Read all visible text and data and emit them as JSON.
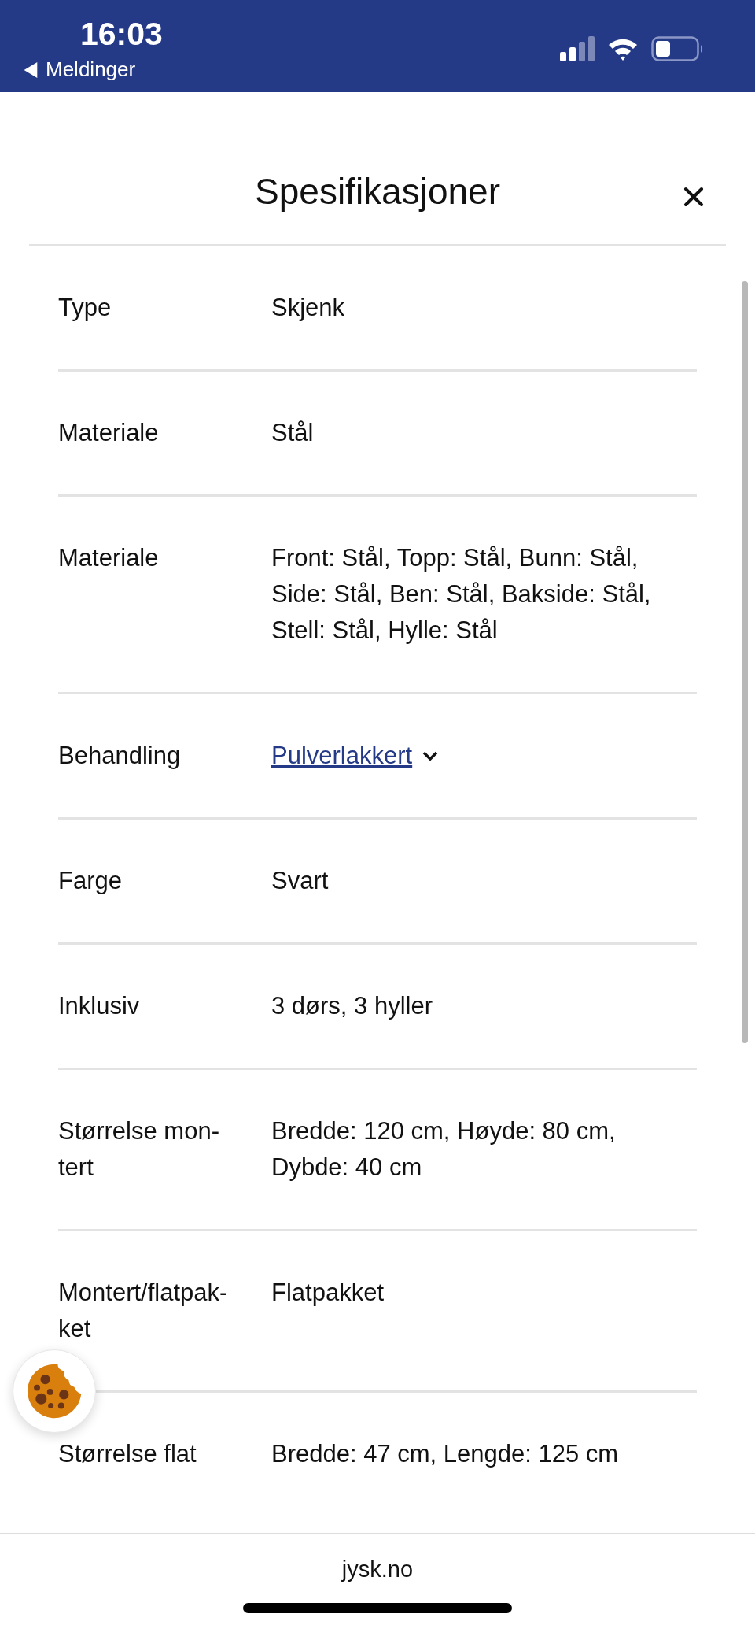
{
  "status_bar": {
    "time": "16:03",
    "back_label": "Meldinger"
  },
  "dialog": {
    "title": "Spesifikasjoner",
    "rows": [
      {
        "kind": "text",
        "label": "Type",
        "value": "Skjenk"
      },
      {
        "kind": "text",
        "label": "Materiale",
        "value": "Stål"
      },
      {
        "kind": "text",
        "label": "Materiale",
        "value": "Front: Stål, Topp: Stål, Bunn: Stål, Side: Stål, Ben: Stål, Bakside: Stål, Stell: Stål, Hylle: Stål"
      },
      {
        "kind": "link",
        "label": "Behandling",
        "value": "Pulverlakkert",
        "expanded": false
      },
      {
        "kind": "text",
        "label": "Farge",
        "value": "Svart"
      },
      {
        "kind": "text",
        "label": "Inklusiv",
        "value": "3 dørs, 3 hyller"
      },
      {
        "kind": "text",
        "label": "Størrelse mon-tert",
        "value": "Bredde: 120 cm, Høyde: 80 cm, Dybde: 40 cm"
      },
      {
        "kind": "text",
        "label": "Montert/flatpak-ket",
        "value": "Flatpakket"
      },
      {
        "kind": "text",
        "label": "Størrelse flat",
        "value": "Bredde: 47 cm, Lengde: 125 cm"
      }
    ]
  },
  "browser_bar": {
    "address": "jysk.no"
  }
}
